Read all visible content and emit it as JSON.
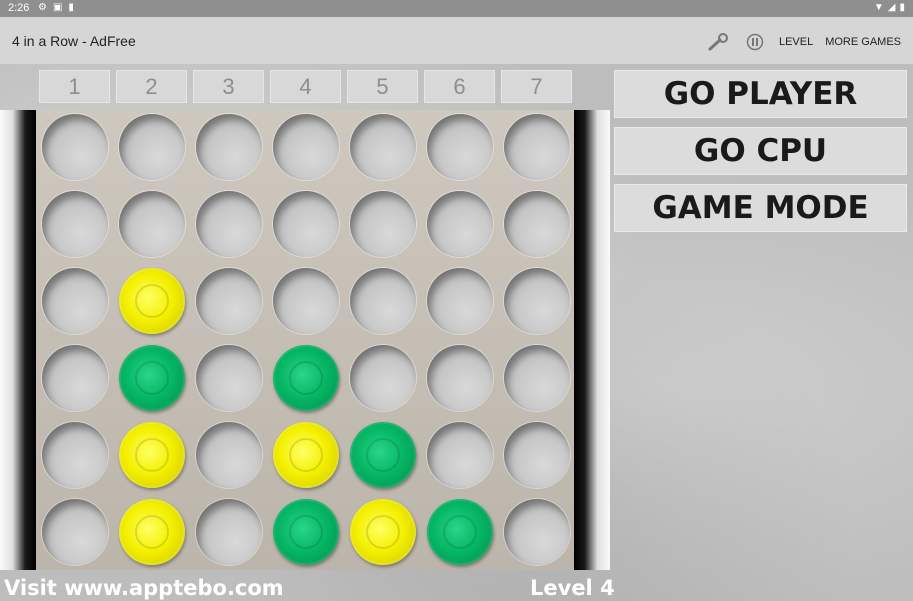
{
  "status_bar": {
    "time": "2:26"
  },
  "app_bar": {
    "title": "4 in a Row - AdFree",
    "level_label": "LEVEL",
    "more_games_label": "MORE GAMES"
  },
  "columns": [
    "1",
    "2",
    "3",
    "4",
    "5",
    "6",
    "7"
  ],
  "board": {
    "rows": [
      [
        "empty",
        "empty",
        "empty",
        "empty",
        "empty",
        "empty",
        "empty"
      ],
      [
        "empty",
        "empty",
        "empty",
        "empty",
        "empty",
        "empty",
        "empty"
      ],
      [
        "empty",
        "yellow",
        "empty",
        "empty",
        "empty",
        "empty",
        "empty"
      ],
      [
        "empty",
        "green",
        "empty",
        "green",
        "empty",
        "empty",
        "empty"
      ],
      [
        "empty",
        "yellow",
        "empty",
        "yellow",
        "green",
        "empty",
        "empty"
      ],
      [
        "empty",
        "yellow",
        "empty",
        "green",
        "yellow",
        "green",
        "empty"
      ]
    ]
  },
  "side_buttons": {
    "go_player": "GO PLAYER",
    "go_cpu": "GO CPU",
    "game_mode": "GAME MODE"
  },
  "footer": {
    "visit": "Visit www.apptebo.com",
    "level": "Level 4"
  },
  "colors": {
    "yellow_piece": "#f4f000",
    "green_piece": "#05b765",
    "app_bar": "#d6d6d6",
    "status_bar": "#8f8f8f"
  }
}
